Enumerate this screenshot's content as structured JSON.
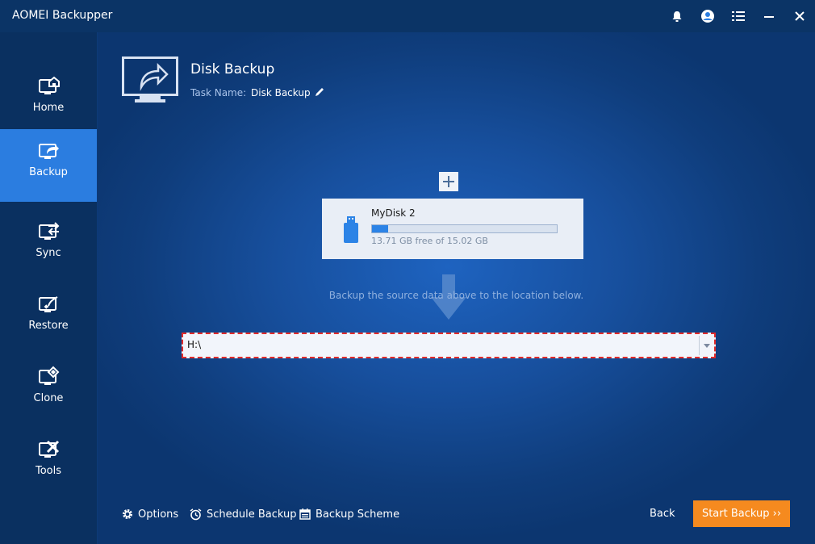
{
  "app": {
    "title": "AOMEI Backupper"
  },
  "titlebar_icons": [
    "bell-icon",
    "user-icon",
    "menu-icon",
    "minimize-icon",
    "close-icon"
  ],
  "sidebar": {
    "items": [
      {
        "label": "Home",
        "icon": "home-icon",
        "active": false
      },
      {
        "label": "Backup",
        "icon": "backup-icon",
        "active": true
      },
      {
        "label": "Sync",
        "icon": "sync-icon",
        "active": false
      },
      {
        "label": "Restore",
        "icon": "restore-icon",
        "active": false
      },
      {
        "label": "Clone",
        "icon": "clone-icon",
        "active": false
      },
      {
        "label": "Tools",
        "icon": "tools-icon",
        "active": false
      }
    ]
  },
  "header": {
    "title": "Disk Backup",
    "task_name_label": "Task Name:",
    "task_name_value": "Disk Backup"
  },
  "source": {
    "disk_name": "MyDisk 2",
    "free_text": "13.71 GB free of 15.02 GB",
    "used_fraction": 0.087
  },
  "hint": "Backup the source data above to the location below.",
  "destination": {
    "value": "H:\\"
  },
  "footer": {
    "options_label": "Options",
    "schedule_label": "Schedule Backup",
    "scheme_label": "Backup Scheme",
    "back_label": "Back",
    "start_label": "Start Backup ››"
  },
  "colors": {
    "accent": "#2b7de0",
    "start_button": "#f58a1f",
    "highlight_border": "#e02b2b"
  }
}
